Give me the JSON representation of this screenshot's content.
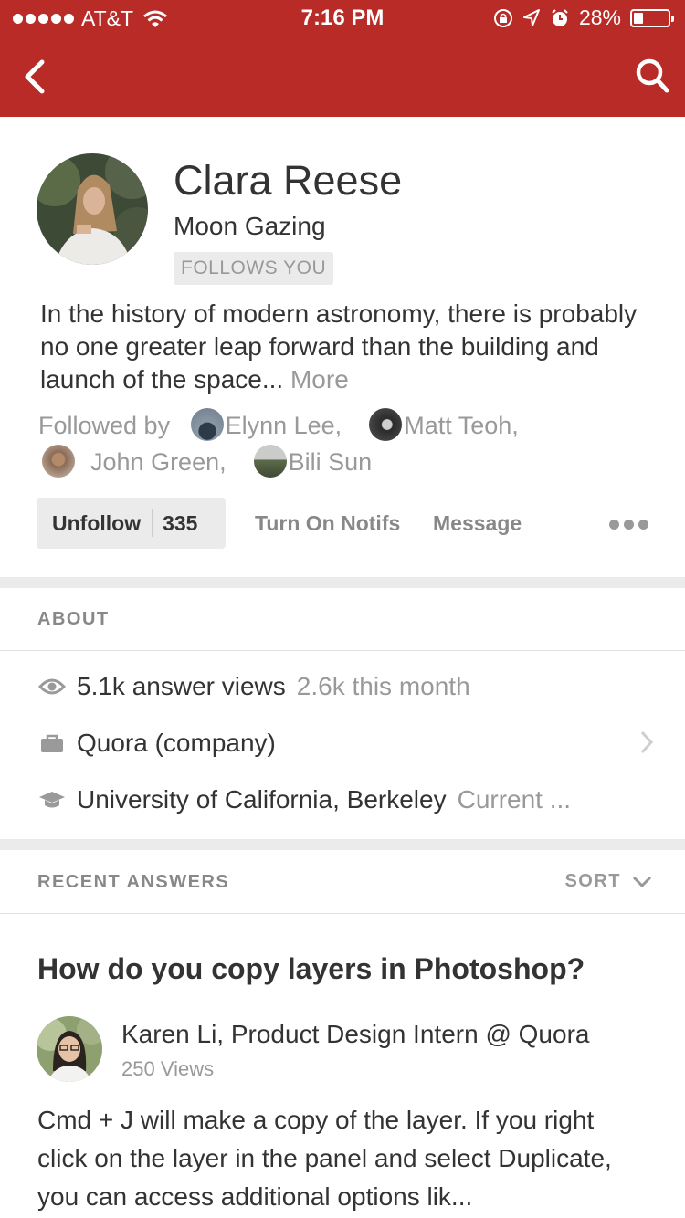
{
  "status_bar": {
    "carrier": "AT&T",
    "time": "7:16 PM",
    "battery": "28%",
    "battery_level": 0.28
  },
  "colors": {
    "brand_red": "#b92b27",
    "muted_gray": "#999999",
    "divider_gray": "#ebebeb"
  },
  "nav": {
    "back_icon": "chevron-left-icon",
    "search_icon": "search-icon"
  },
  "profile": {
    "name": "Clara Reese",
    "tagline": "Moon Gazing",
    "follows_badge": "FOLLOWS YOU",
    "bio": "In the history of modern astronomy, there is probably no one greater leap forward than the building and launch of the space...",
    "more_link": "More",
    "followed_by_label": "Followed by",
    "followers": [
      {
        "name": "Elynn Lee,"
      },
      {
        "name": "Matt Teoh,"
      },
      {
        "name": "John Green,"
      },
      {
        "name": "Bili Sun"
      }
    ]
  },
  "actions": {
    "unfollow_label": "Unfollow",
    "follower_count": "335",
    "notifs_label": "Turn On Notifs",
    "message_label": "Message",
    "overflow_icon": "more-dots-icon"
  },
  "about": {
    "heading": "ABOUT",
    "views": "5.1k answer views",
    "views_month": "2.6k this month",
    "employment": "Quora (company)",
    "education": "University of California, Berkeley",
    "education_sub": "Current ..."
  },
  "recent": {
    "heading": "RECENT ANSWERS",
    "sort_label": "SORT"
  },
  "answer": {
    "question": "How do you copy layers in Photoshop?",
    "author": "Karen Li, Product Design Intern @ Quora",
    "views": "250 Views",
    "text": "Cmd + J will make a copy of the layer. If you right click on the layer in the panel and select Duplicate, you can access additional options lik..."
  }
}
